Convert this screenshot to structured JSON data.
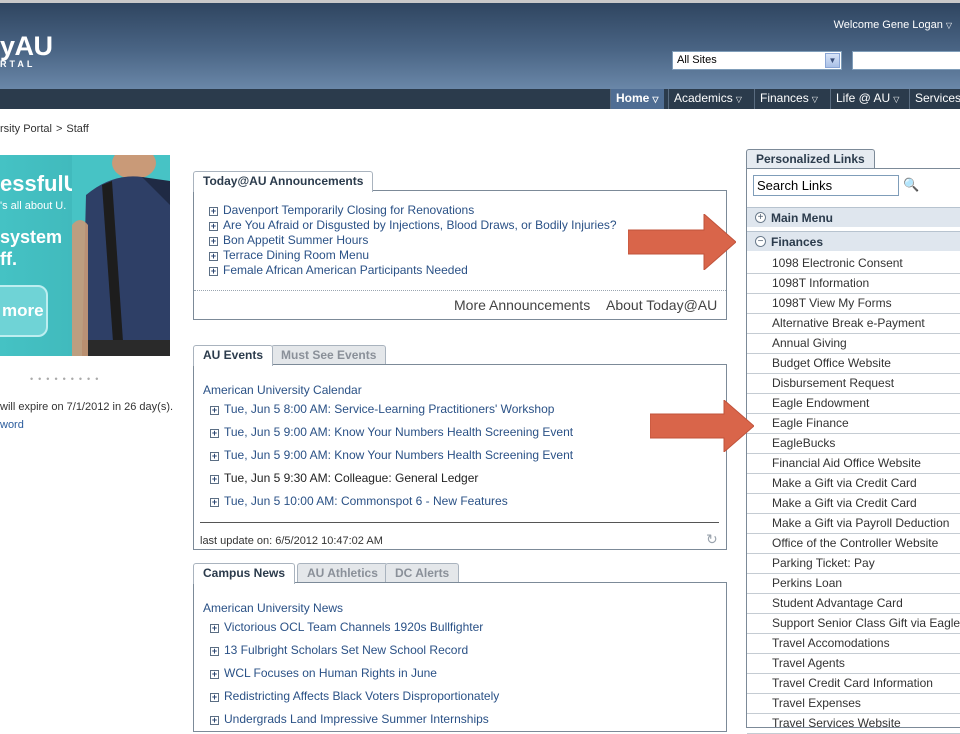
{
  "header": {
    "logo_main": "yAU",
    "logo_sub": "RTAL",
    "welcome": "Welcome Gene Logan",
    "site_select_value": "All Sites"
  },
  "nav": [
    {
      "label": "Home",
      "active": true
    },
    {
      "label": "Academics",
      "active": false
    },
    {
      "label": "Finances",
      "active": false
    },
    {
      "label": "Life @ AU",
      "active": false
    },
    {
      "label": "Services",
      "active": false
    }
  ],
  "breadcrumb": {
    "parent": "rsity Portal",
    "separator": ">",
    "current": "Staff"
  },
  "promo": {
    "title": "essfulU",
    "tagline": "'s all about U.",
    "line1": "system",
    "line2": "ff.",
    "button": "more",
    "dots": "•••••••••",
    "expire_note": "will expire on 7/1/2012 in 26 day(s).",
    "password_link": "word"
  },
  "announcements": {
    "tab": "Today@AU Announcements",
    "items": [
      "Davenport Temporarily Closing for Renovations",
      "Are You Afraid or Disgusted by Injections, Blood Draws, or Bodily Injuries?",
      "Bon Appetit Summer Hours",
      "Terrace Dining Room Menu",
      "Female African American Participants Needed"
    ],
    "more_link": "More Announcements",
    "about_link": "About Today@AU"
  },
  "events": {
    "tabs": [
      "AU Events",
      "Must See Events"
    ],
    "calendar_link": "American University Calendar",
    "items": [
      "Tue, Jun 5 8:00 AM: Service-Learning Practitioners' Workshop",
      "Tue, Jun 5 9:00 AM: Know Your Numbers Health Screening Event",
      "Tue, Jun 5 9:00 AM: Know Your Numbers Health Screening Event",
      "Tue, Jun 5 9:30 AM: Colleague: General Ledger",
      "Tue, Jun 5 10:00 AM: Commonspot 6 - New Features"
    ],
    "last_update": "last update on: 6/5/2012 10:47:02 AM"
  },
  "news": {
    "tabs": [
      "Campus News",
      "AU Athletics",
      "DC Alerts"
    ],
    "news_link": "American University News",
    "items": [
      "Victorious OCL Team Channels 1920s Bullfighter",
      "13 Fulbright Scholars Set New School Record",
      "WCL Focuses on Human Rights in June",
      "Redistricting Affects Black Voters Disproportionately",
      "Undergrads Land Impressive Summer Internships"
    ]
  },
  "personalized_links": {
    "tab": "Personalized Links",
    "search_value": "Search Links",
    "main_menu": "Main Menu",
    "finances": "Finances",
    "links": [
      "1098 Electronic Consent",
      "1098T Information",
      "1098T View My Forms",
      "Alternative Break e-Payment",
      "Annual Giving",
      "Budget Office Website",
      "Disbursement Request",
      "Eagle Endowment",
      "Eagle Finance",
      "EagleBucks",
      "Financial Aid Office Website",
      "Make a Gift via Credit Card",
      "Make a Gift via Credit Card",
      "Make a Gift via Payroll Deduction",
      "Office of the Controller Website",
      "Parking Ticket: Pay",
      "Perkins Loan",
      "Student Advantage Card",
      "Support Senior Class Gift via Eagle",
      "Travel Accomodations",
      "Travel Agents",
      "Travel Credit Card Information",
      "Travel Expenses",
      "Travel Services Website"
    ]
  },
  "colors": {
    "header_dark": "#2f4560",
    "nav_bar": "#2b3b4c",
    "link_blue": "#2a5186",
    "arrow_red": "#d9654a",
    "promo_teal": "#45c2c4"
  }
}
